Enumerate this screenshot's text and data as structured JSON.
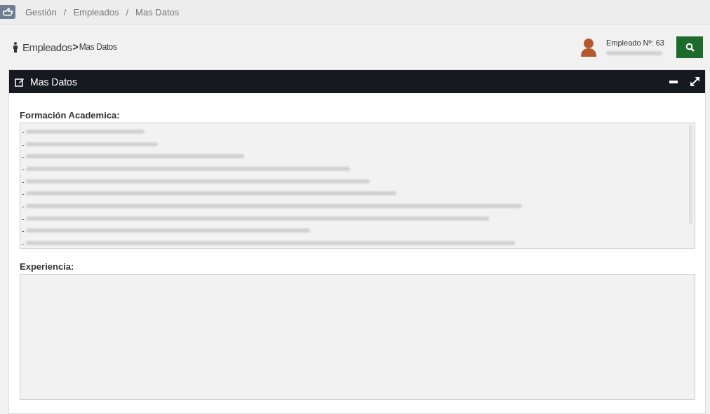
{
  "breadcrumb": {
    "items": [
      {
        "label": "Gestión"
      },
      {
        "label": "Empleados"
      },
      {
        "label": "Mas Datos"
      }
    ],
    "separator": "/"
  },
  "page_header": {
    "section": "Empleados",
    "arrow": ">",
    "current": "Mas Datos"
  },
  "employee": {
    "number_label": "Empleado Nº: 63"
  },
  "panel": {
    "title": "Mas Datos",
    "fields": [
      {
        "label": "Formación Academica:",
        "lines": [
          "-",
          "-",
          "-",
          "-",
          "-",
          "-",
          "-",
          "-",
          "-",
          "-"
        ]
      },
      {
        "label": "Experiencia:"
      }
    ]
  }
}
